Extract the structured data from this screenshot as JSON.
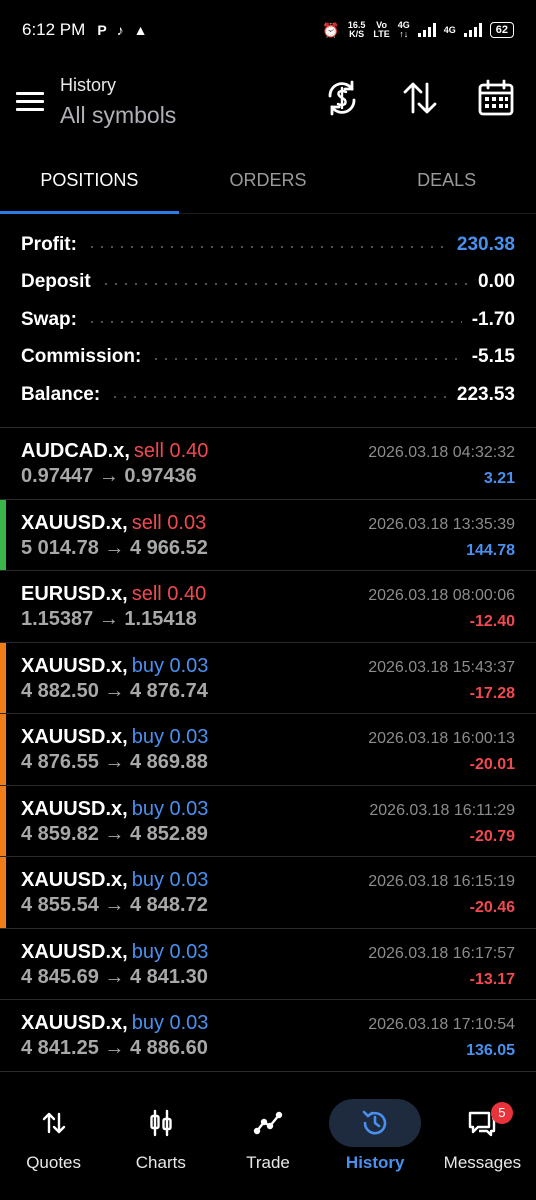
{
  "status_bar": {
    "time": "6:12 PM",
    "icons": [
      "p-icon",
      "tiktok-icon",
      "android-icon"
    ],
    "net_speed_value": "16.5",
    "net_speed_unit": "K/S",
    "volte_top": "Vo",
    "volte_bottom": "LTE",
    "sig1_top": "4G",
    "sig1_bottom": "↑↓",
    "sig2_top": "4G",
    "battery": "62"
  },
  "header": {
    "title": "History",
    "subtitle": "All symbols"
  },
  "tabs": [
    {
      "label": "POSITIONS",
      "active": true
    },
    {
      "label": "ORDERS",
      "active": false
    },
    {
      "label": "DEALS",
      "active": false
    }
  ],
  "summary": [
    {
      "label": "Profit:",
      "value": "230.38",
      "color": "#4a90f0"
    },
    {
      "label": "Deposit",
      "value": "0.00",
      "color": "#ffffff"
    },
    {
      "label": "Swap:",
      "value": "-1.70",
      "color": "#ffffff"
    },
    {
      "label": "Commission:",
      "value": "-5.15",
      "color": "#ffffff"
    },
    {
      "label": "Balance:",
      "value": "223.53",
      "color": "#ffffff"
    }
  ],
  "positions": [
    {
      "symbol": "AUDCAD.x,",
      "side": "sell 0.40",
      "side_color": "#f0494f",
      "prices": "0.97447 → 0.97436",
      "time": "2026.03.18 04:32:32",
      "pl": "3.21",
      "pl_color": "#4a90f0",
      "marker": ""
    },
    {
      "symbol": "XAUUSD.x,",
      "side": "sell 0.03",
      "side_color": "#f0494f",
      "prices": "5 014.78 → 4 966.52",
      "time": "2026.03.18 13:35:39",
      "pl": "144.78",
      "pl_color": "#4a90f0",
      "marker": "#3bb54a"
    },
    {
      "symbol": "EURUSD.x,",
      "side": "sell 0.40",
      "side_color": "#f0494f",
      "prices": "1.15387 → 1.15418",
      "time": "2026.03.18 08:00:06",
      "pl": "-12.40",
      "pl_color": "#f0494f",
      "marker": ""
    },
    {
      "symbol": "XAUUSD.x,",
      "side": "buy 0.03",
      "side_color": "#4a90f0",
      "prices": "4 882.50 → 4 876.74",
      "time": "2026.03.18 15:43:37",
      "pl": "-17.28",
      "pl_color": "#f0494f",
      "marker": "#f07d1a"
    },
    {
      "symbol": "XAUUSD.x,",
      "side": "buy 0.03",
      "side_color": "#4a90f0",
      "prices": "4 876.55 → 4 869.88",
      "time": "2026.03.18 16:00:13",
      "pl": "-20.01",
      "pl_color": "#f0494f",
      "marker": "#f07d1a"
    },
    {
      "symbol": "XAUUSD.x,",
      "side": "buy 0.03",
      "side_color": "#4a90f0",
      "prices": "4 859.82 → 4 852.89",
      "time": "2026.03.18 16:11:29",
      "pl": "-20.79",
      "pl_color": "#f0494f",
      "marker": "#f07d1a"
    },
    {
      "symbol": "XAUUSD.x,",
      "side": "buy 0.03",
      "side_color": "#4a90f0",
      "prices": "4 855.54 → 4 848.72",
      "time": "2026.03.18 16:15:19",
      "pl": "-20.46",
      "pl_color": "#f0494f",
      "marker": "#f07d1a"
    },
    {
      "symbol": "XAUUSD.x,",
      "side": "buy 0.03",
      "side_color": "#4a90f0",
      "prices": "4 845.69 → 4 841.30",
      "time": "2026.03.18 16:17:57",
      "pl": "-13.17",
      "pl_color": "#f0494f",
      "marker": ""
    },
    {
      "symbol": "XAUUSD.x,",
      "side": "buy 0.03",
      "side_color": "#4a90f0",
      "prices": "4 841.25 → 4 886.60",
      "time": "2026.03.18 17:10:54",
      "pl": "136.05",
      "pl_color": "#4a90f0",
      "marker": ""
    }
  ],
  "bottom_nav": [
    {
      "label": "Quotes",
      "icon": "quotes-icon",
      "active": false
    },
    {
      "label": "Charts",
      "icon": "charts-icon",
      "active": false
    },
    {
      "label": "Trade",
      "icon": "trade-icon",
      "active": false
    },
    {
      "label": "History",
      "icon": "history-icon",
      "active": true
    },
    {
      "label": "Messages",
      "icon": "messages-icon",
      "active": false,
      "badge": "5"
    }
  ]
}
